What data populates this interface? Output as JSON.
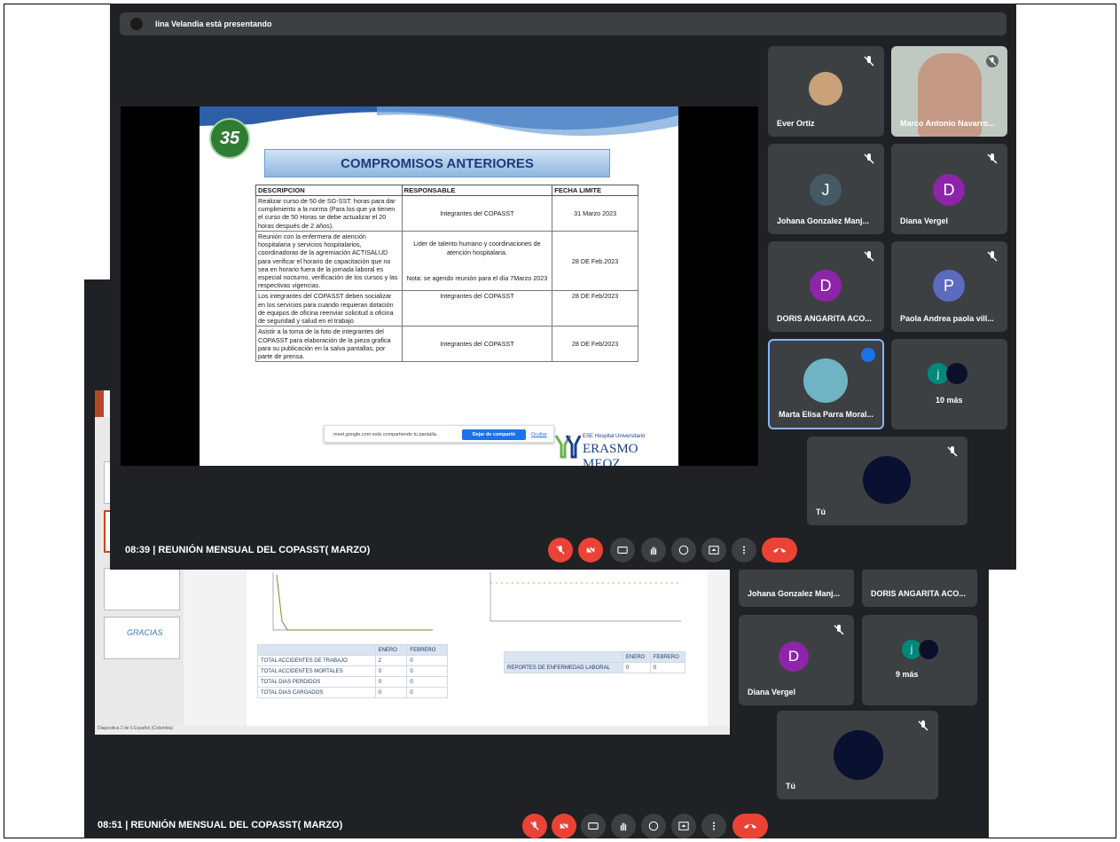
{
  "front": {
    "presenter_text": "lina Velandia está presentando",
    "meeting_info": "08:39  |  REUNIÓN MENSUAL DEL COPASST( MARZO)",
    "slide": {
      "logo": "35",
      "logo_sub": "AÑOS",
      "title": "COMPROMISOS ANTERIORES",
      "headers": [
        "DESCRIPCION",
        "RESPONSABLE",
        "FECHA LIMITE"
      ],
      "rows": [
        {
          "desc": "Realizar curso de 50 de SG-SST. horas para dar cumplimiento a la norma (Para los que ya tienen el curso de 50 Horas se debe actualizar el 20 horas después de 2 años).",
          "resp": "Integrantes del COPASST",
          "note": "",
          "date": "31 Marzo 2023"
        },
        {
          "desc": "Reunión con la enfermera de atención hospitalaria y servicios hospitalarios, coordinadoras de la agremiación ACTISALUD para verificar el horario de capacitación que no sea en horario fuera de la jornada laboral es especial nocturno, verificación de los cursos y las respectivas vigencias.",
          "resp": "Lider de talento humano y coordinaciones de atención hospitalaria.",
          "note": "Nota: se agendo reunión para el día 7Marzo 2023",
          "date": "28 DE Feb.2023"
        },
        {
          "desc": "Los integrantes del COPASST deben socializar en los servicios para cuando requieran dotación de equipos de oficina reenviar solicitud a oficina de seguridad y salud en el trabajo",
          "resp": "Integrantes del COPASST",
          "note": "",
          "date": "28 DE Feb/2023"
        },
        {
          "desc": "Asistir a la toma de la foto de integrantes del COPASST para elaboración de la pieza grafica para su publicación en la salva pantallas, por parte de prensa.",
          "resp": "Integrantes del COPASST",
          "note": "",
          "date": "28 DE Feb/2023"
        }
      ],
      "share_text": "meet.google.com está compartiendo tu pantalla.",
      "share_button": "Dejar de compartir",
      "share_hide": "Ocultar",
      "brand_small": "ESE Hospital Universitario",
      "brand_big": "ERASMO MEOZ"
    },
    "participants": [
      {
        "name": "Ever Ortiz",
        "type": "photo"
      },
      {
        "name": "Marco Antonio Navarro...",
        "type": "video"
      },
      {
        "name": "Johana Gonzalez Manj...",
        "initial": "J",
        "color": "#455a64"
      },
      {
        "name": "Diana Vergel",
        "initial": "D",
        "color": "#8e24aa"
      },
      {
        "name": "DORIS ANGARITA ACO...",
        "initial": "D",
        "color": "#8e24aa"
      },
      {
        "name": "Paola Andrea paola vill...",
        "initial": "P",
        "color": "#5c6bc0"
      },
      {
        "name": "Marta Elisa Parra Moral...",
        "type": "photo"
      },
      {
        "name": "10 más",
        "initial": "j",
        "color": "#00897b"
      },
      {
        "name": "Tú",
        "type": "self"
      }
    ]
  },
  "back": {
    "meeting_info": "08:51  |  REUNIÓN MENSUAL DEL COPASST( MARZO)",
    "thumb_text": "GRACIAS",
    "table_left": {
      "headers": [
        "",
        "ENERO",
        "FEBRERO"
      ],
      "rows": [
        [
          "TOTAL ACCIDENTES DE TRABAJO",
          "2",
          "0"
        ],
        [
          "TOTAL ACCIDENTES MORTALES",
          "0",
          "0"
        ],
        [
          "TOTAL DIAS PERDIDOS",
          "0",
          "0"
        ],
        [
          "TOTAL DIAS CARGADOS",
          "0",
          "0"
        ]
      ]
    },
    "table_right": {
      "headers": [
        "",
        "ENERO",
        "FEBRERO"
      ],
      "rows": [
        [
          "REPORTES DE ENFERMEDAD LABORAL",
          "0",
          "0"
        ]
      ]
    },
    "status_left": "Diapositiva 2 de 6     Español (Colombia)",
    "participants": [
      {
        "name": "Johana Gonzalez Manj..."
      },
      {
        "name": "DORIS ANGARITA ACO..."
      },
      {
        "name": "Diana Vergel",
        "initial": "D",
        "color": "#8e24aa"
      },
      {
        "name": "9 más",
        "initial": "j",
        "color": "#00897b"
      },
      {
        "name": "Tú"
      }
    ]
  },
  "colors": {
    "meet_bg": "#202124",
    "tile_bg": "#3c4043",
    "danger": "#ea4335",
    "accent": "#1a73e8"
  }
}
